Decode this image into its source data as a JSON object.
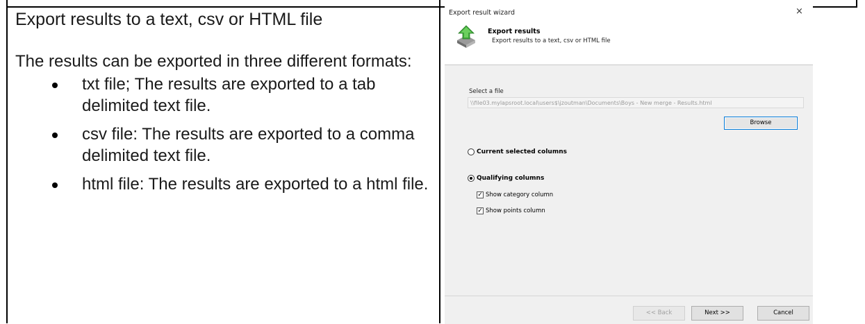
{
  "left": {
    "heading": "Export results to a text, csv or HTML file",
    "intro": "The results can be exported in three different formats:",
    "bullets": [
      "txt file; The results are exported to a tab delimited text file.",
      "csv file: The results are exported to a comma delimited text file.",
      "html file: The results are exported to a html file."
    ]
  },
  "dialog": {
    "window_title": "Export result wizard",
    "close_glyph": "×",
    "header_title": "Export results",
    "header_subtitle": "Export results to a text, csv or HTML file",
    "header_icon": "export-arrow-icon",
    "select_file_label": "Select a file",
    "file_path": "\\\\file03.mylapsroot.local\\users$\\jzoutman\\Documents\\Boys - New merge - Results.html",
    "browse_label": "Browse",
    "radio_current": {
      "label": "Current selected columns",
      "selected": false
    },
    "radio_qualifying": {
      "label": "Qualifying columns",
      "selected": true
    },
    "check_category": {
      "label": "Show category column",
      "checked": true
    },
    "check_points": {
      "label": "Show points column",
      "checked": true
    },
    "back_label": "<< Back",
    "next_label": "Next >>",
    "cancel_label": "Cancel"
  }
}
